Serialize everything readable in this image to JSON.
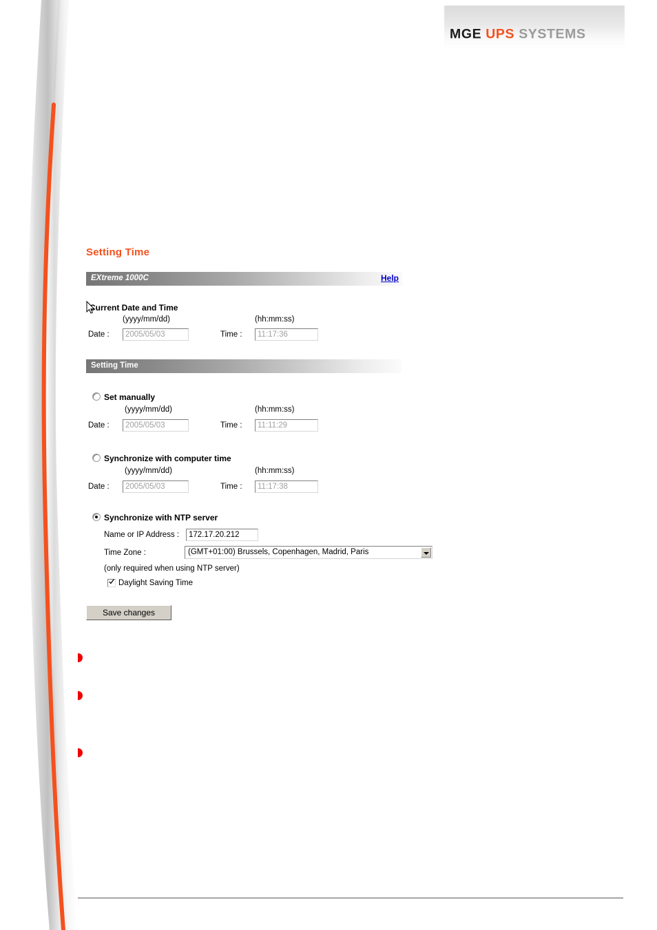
{
  "brand": {
    "part1": "MGE",
    "part2": "UPS",
    "part3": "SYSTEMS",
    "accent_color": "#f4511e",
    "gray_color": "#9a9a9a"
  },
  "page": {
    "title": "Setting Time",
    "title_color": "#f4511e"
  },
  "device_bar": {
    "model": "EXtreme 1000C",
    "help_label": "Help",
    "help_color": "#0000c8"
  },
  "current_section": {
    "heading": "Current Date and Time",
    "date_format_hint": "(yyyy/mm/dd)",
    "time_format_hint": "(hh:mm:ss)",
    "date_label": "Date :",
    "time_label": "Time :",
    "date_value": "2005/05/03",
    "time_value": "11:17:36"
  },
  "setting_section": {
    "bar_label": "Setting Time",
    "manual": {
      "heading": "Set manually",
      "selected": false,
      "date_format_hint": "(yyyy/mm/dd)",
      "time_format_hint": "(hh:mm:ss)",
      "date_label": "Date :",
      "time_label": "Time :",
      "date_value": "2005/05/03",
      "time_value": "11:11:29"
    },
    "computer": {
      "heading": "Synchronize with computer time",
      "selected": false,
      "date_format_hint": "(yyyy/mm/dd)",
      "time_format_hint": "(hh:mm:ss)",
      "date_label": "Date :",
      "time_label": "Time :",
      "date_value": "2005/05/03",
      "time_value": "11:17:38"
    },
    "ntp": {
      "heading": "Synchronize with NTP server",
      "selected": true,
      "address_label": "Name or IP Address :",
      "address_value": "172.17.20.212",
      "timezone_label": "Time Zone :",
      "timezone_value": "(GMT+01:00) Brussels, Copenhagen, Madrid, Paris",
      "note": "(only required when using NTP server)",
      "dst_label": "Daylight Saving Time",
      "dst_checked": true
    }
  },
  "actions": {
    "save_label": "Save changes"
  },
  "decor": {
    "curve_color": "#f4511e",
    "bullet_color": "#ee0000",
    "bullet_count": 3
  }
}
